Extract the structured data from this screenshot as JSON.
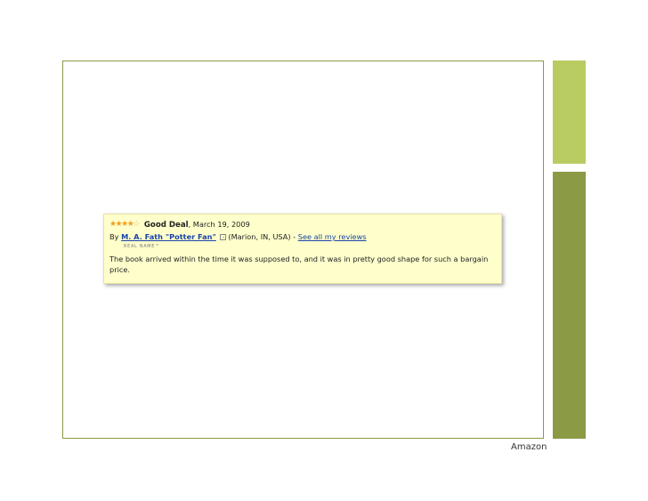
{
  "review": {
    "stars_filled": "★★★★",
    "stars_empty": "☆",
    "rating": "4 of 5 stars",
    "title": "Good Deal",
    "date": ", March 19, 2009",
    "by_label": "By ",
    "author": "M. A. Fath \"Potter Fan\"",
    "location": "(Marion, IN, USA)",
    "separator": " - ",
    "see_all": "See all my reviews",
    "badge": "REAL NAME™",
    "body": "The book arrived within the time it was supposed to, and it was in pretty good shape for such a bargain price."
  },
  "caption": "Amazon",
  "colors": {
    "accent_light": "#b8cc62",
    "accent_dark": "#8a9a45",
    "review_bg": "#ffffcc",
    "link": "#1a44a8",
    "star": "#f0a020"
  }
}
